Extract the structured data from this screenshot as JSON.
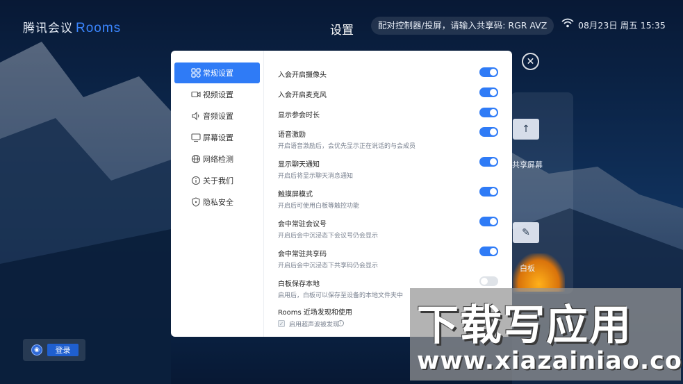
{
  "header": {
    "logo_text": "腾讯会议",
    "logo_suffix": "Rooms",
    "title": "设置",
    "pair_hint": "配对控制器/投屏，请输入共享码:  RGR AVZ",
    "datetime": "08月23日 周五 15:35",
    "wifi_icon": "wifi-icon",
    "close_icon": "close-icon"
  },
  "background": {
    "share_label": "共享屏幕",
    "whiteboard_label": "白板",
    "login_label": "登录"
  },
  "nav": {
    "items": [
      {
        "label": "常规设置",
        "icon": "grid-icon",
        "active": true
      },
      {
        "label": "视频设置",
        "icon": "camera-icon",
        "active": false
      },
      {
        "label": "音频设置",
        "icon": "speaker-icon",
        "active": false
      },
      {
        "label": "屏幕设置",
        "icon": "monitor-icon",
        "active": false
      },
      {
        "label": "网络检测",
        "icon": "globe-icon",
        "active": false
      },
      {
        "label": "关于我们",
        "icon": "info-icon",
        "active": false
      },
      {
        "label": "隐私安全",
        "icon": "shield-icon",
        "active": false
      }
    ]
  },
  "settings": [
    {
      "title": "入会开启摄像头",
      "desc": "",
      "on": true
    },
    {
      "title": "入会开启麦克风",
      "desc": "",
      "on": true
    },
    {
      "title": "显示参会时长",
      "desc": "",
      "on": true
    },
    {
      "title": "语音激励",
      "desc": "开启语音激励后，会优先显示正在说话的与会成员",
      "on": true
    },
    {
      "title": "显示聊天通知",
      "desc": "开启后将显示聊天消息通知",
      "on": true
    },
    {
      "title": "触摸屏模式",
      "desc": "开启后可使用白板等触控功能",
      "on": true
    },
    {
      "title": "会中常驻会议号",
      "desc": "开启后会中沉浸态下会议号仍会显示",
      "on": true
    },
    {
      "title": "会中常驻共享码",
      "desc": "开启后会中沉浸态下共享码仍会显示",
      "on": true
    },
    {
      "title": "白板保存本地",
      "desc": "启用后，白板可以保存至设备的本地文件夹中",
      "on": false
    }
  ],
  "rooms_section": {
    "title": "Rooms 近场发现和使用",
    "checkbox_label": "启用超声波被发现",
    "checked": true
  },
  "watermark": {
    "title": "下载写应用",
    "url": "www.xiazainiao.com"
  },
  "colors": {
    "accent": "#2f7bf6",
    "logo_rooms": "#3b86ff",
    "toggle_off": "#dfe3e8"
  }
}
